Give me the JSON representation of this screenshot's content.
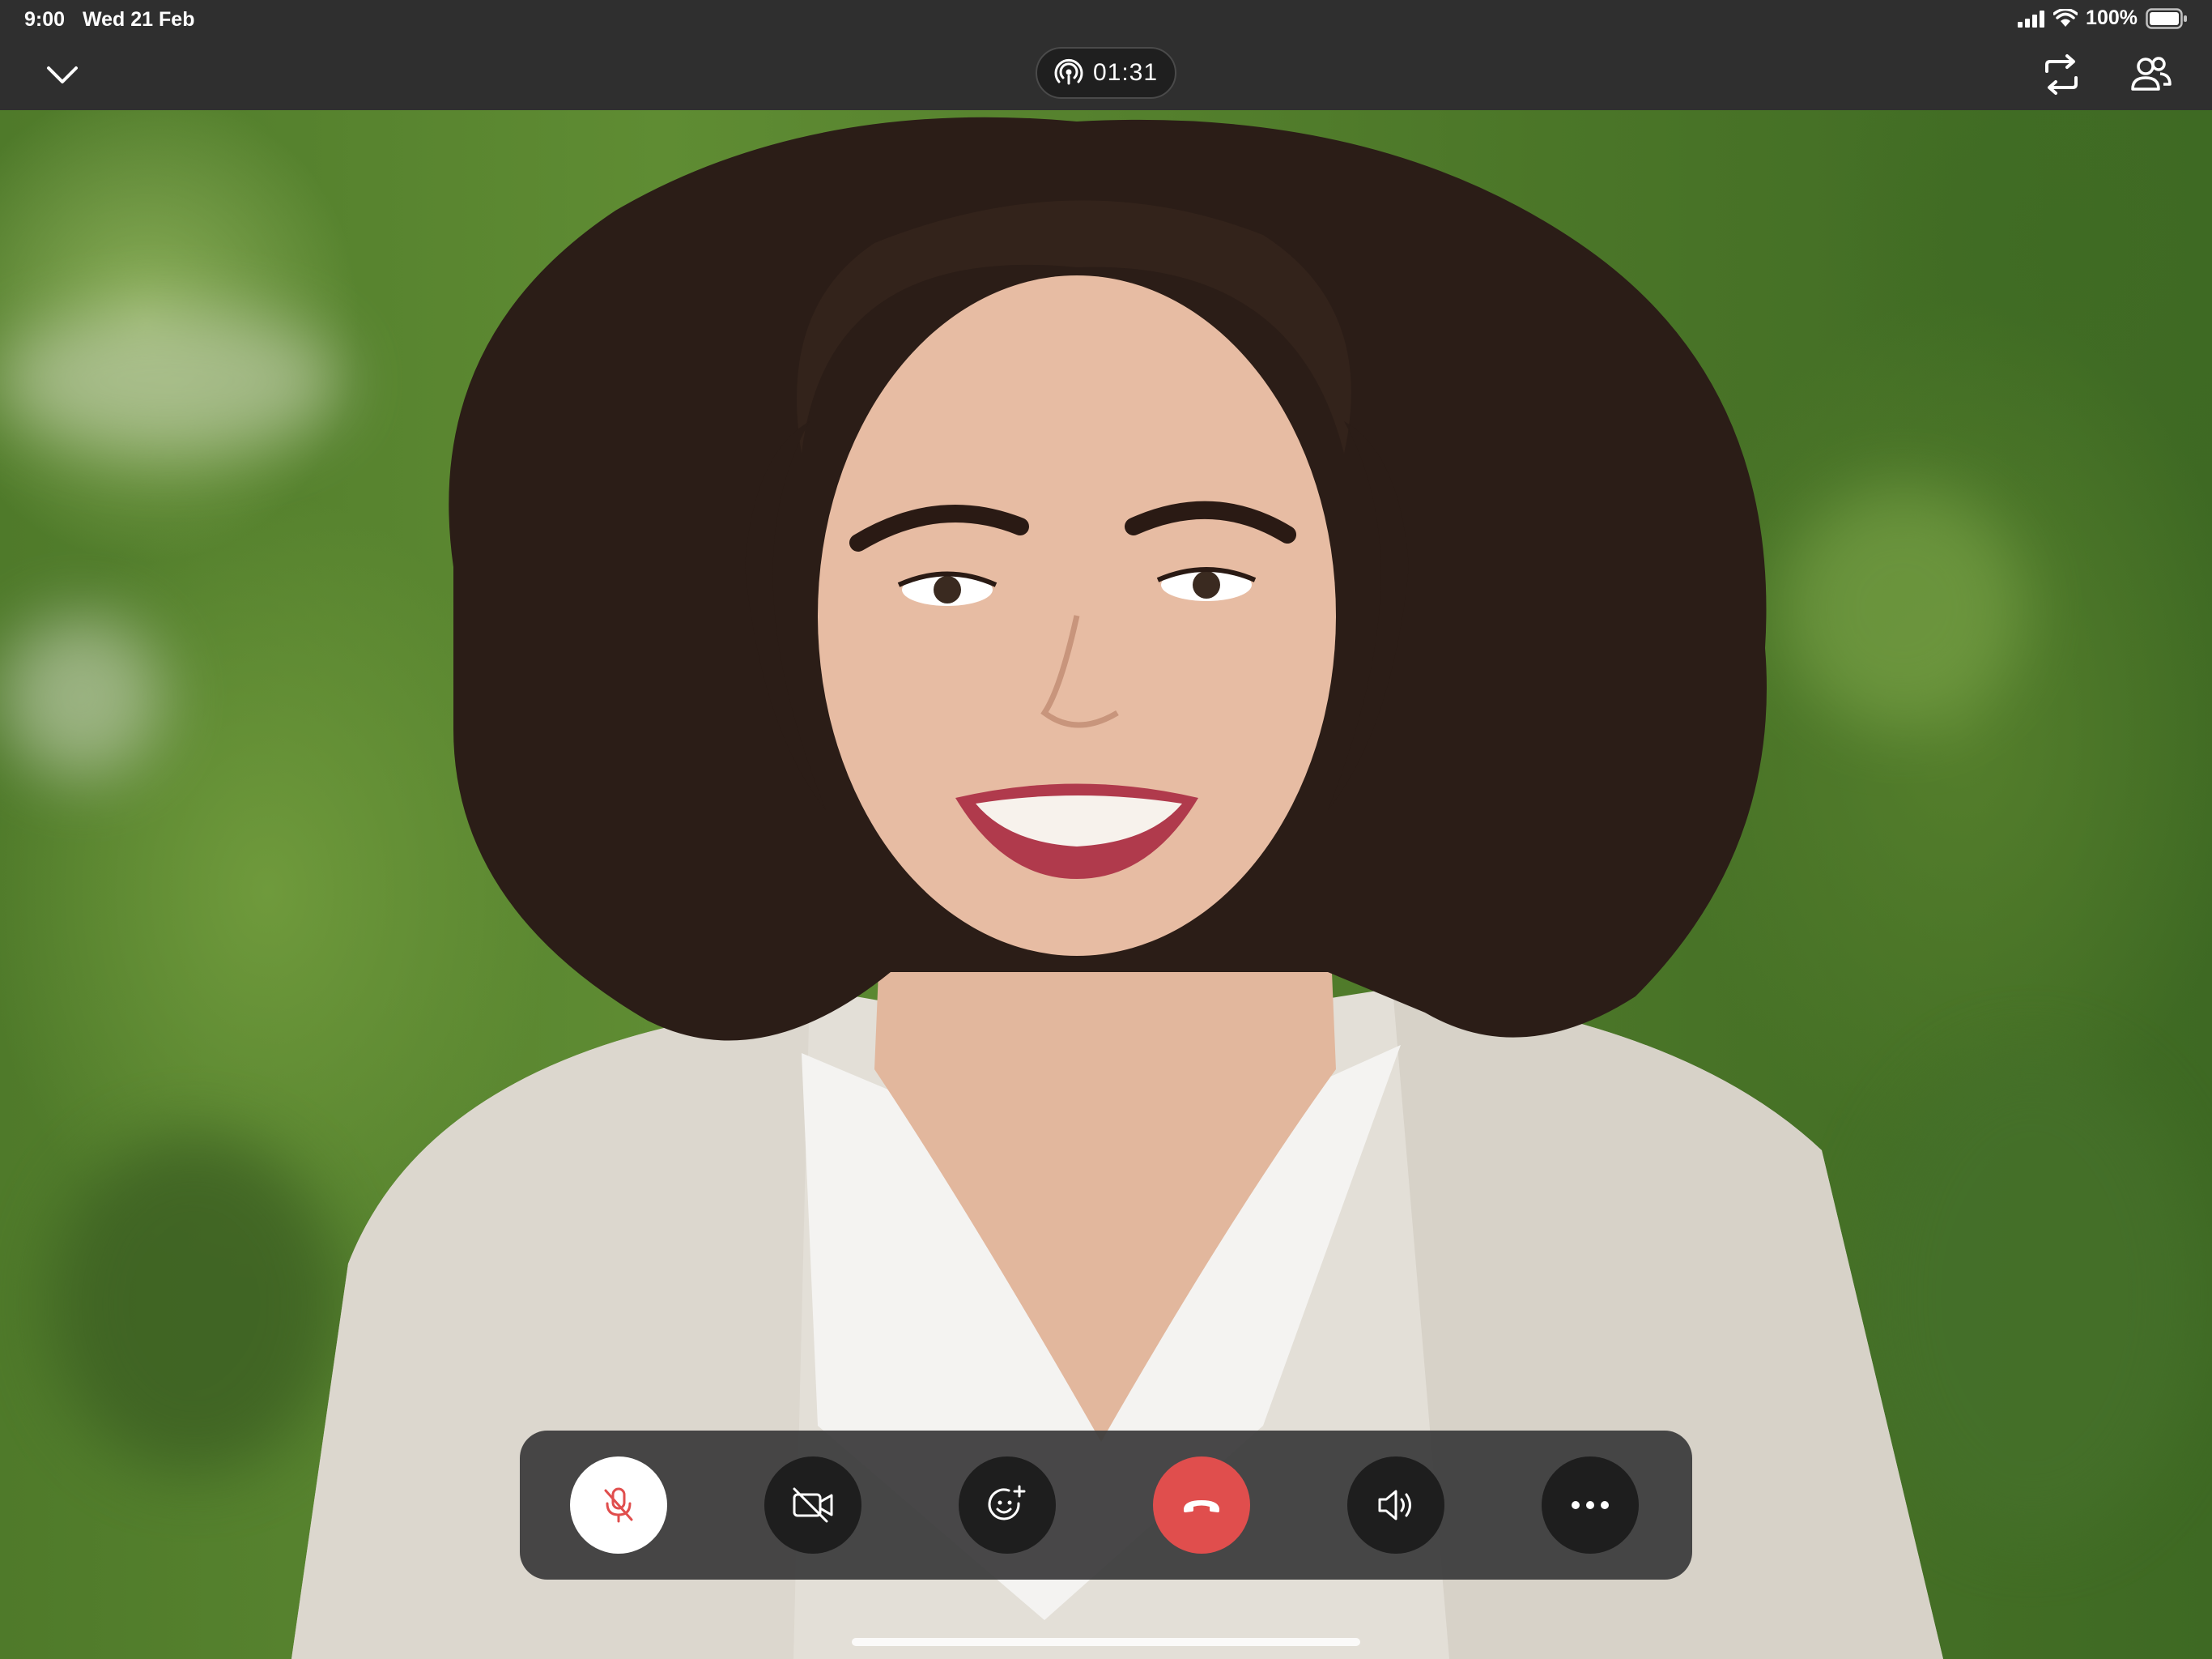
{
  "status_bar": {
    "time": "9:00",
    "date": "Wed 21 Feb",
    "battery": "100%",
    "icons": [
      "signal-icon",
      "wifi-icon",
      "battery-icon"
    ]
  },
  "call": {
    "duration": "01:31",
    "duration_icon": "broadcast-icon"
  },
  "top_bar": {
    "left_icon": "chevron-down-icon",
    "right_icons": [
      "switch-camera-icon",
      "participants-icon"
    ]
  },
  "controls": [
    {
      "name": "mute",
      "icon": "microphone-muted-icon",
      "state": "muted"
    },
    {
      "name": "video",
      "icon": "video-off-icon",
      "state": "off"
    },
    {
      "name": "reactions",
      "icon": "emoji-add-icon"
    },
    {
      "name": "end-call",
      "icon": "hang-up-icon"
    },
    {
      "name": "speaker",
      "icon": "speaker-icon"
    },
    {
      "name": "more",
      "icon": "more-icon"
    }
  ],
  "colors": {
    "top_bar": "#2f2f2f",
    "dock": "#38383a",
    "button": "#1e1e1e",
    "end_call": "#e04e4d",
    "muted_icon": "#e04e4d"
  }
}
